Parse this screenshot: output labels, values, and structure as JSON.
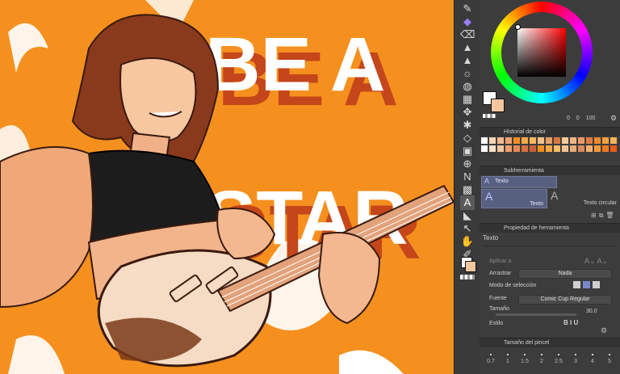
{
  "canvas": {
    "text_line1": "BE A",
    "text_line2": "STAR"
  },
  "toolbar": {
    "tools": [
      "pen-icon",
      "brush-icon",
      "eraser-icon",
      "fill-icon",
      "blend-icon",
      "airbrush-icon",
      "gradient-icon",
      "figure-icon",
      "frame-icon",
      "select-icon",
      "lasso-icon",
      "move-icon",
      "text-icon",
      "balloon-icon",
      "ruler-icon",
      "hand-icon",
      "zoom-icon",
      "eyedropper-icon",
      "color-swatch-icon"
    ]
  },
  "color_panel": {
    "values": [
      "0",
      "0",
      "100"
    ]
  },
  "history_panel": {
    "title": "Historial de color",
    "colors": [
      "#ffffff",
      "#f6d5b8",
      "#f2b88f",
      "#f0a070",
      "#f5901f",
      "#f7a848",
      "#f8b860",
      "#f2c18a",
      "#e8a064",
      "#d87840",
      "#f6ca9a",
      "#f3b487",
      "#ee9a66",
      "#e27a44",
      "#f08a2a",
      "#f5a03c",
      "#f9b45a",
      "#ffffff",
      "#f9e0c8",
      "#f4c7a0",
      "#ef9e6d",
      "#e88a55",
      "#d97040",
      "#c8603a",
      "#f5901f",
      "#f8a646",
      "#fbbc66",
      "#f3c698",
      "#e9aa78",
      "#de8a5a",
      "#f6b070",
      "#f89a3a",
      "#f07c22",
      "#e85c1c"
    ]
  },
  "subtool_panel": {
    "title": "Subherramienta",
    "group": "Texto",
    "options": [
      "Texto",
      "Texto circular"
    ]
  },
  "tool_property": {
    "title": "Propiedad de herramienta",
    "tool_name": "Texto",
    "apply_label": "Aplicar a",
    "drag_label": "Arrastrar",
    "drag_value": "Nada",
    "selection_mode_label": "Modo de selección",
    "font_label": "Fuente",
    "font_value": "Comic Cup Regular",
    "size_label": "Tamaño",
    "size_value": "30.0",
    "style_label": "Estilo"
  },
  "brush_size_panel": {
    "title": "Tamaño del pincel",
    "sizes": [
      "0.7",
      "1",
      "1.5",
      "2",
      "2.5",
      "3",
      "4",
      "5"
    ]
  }
}
